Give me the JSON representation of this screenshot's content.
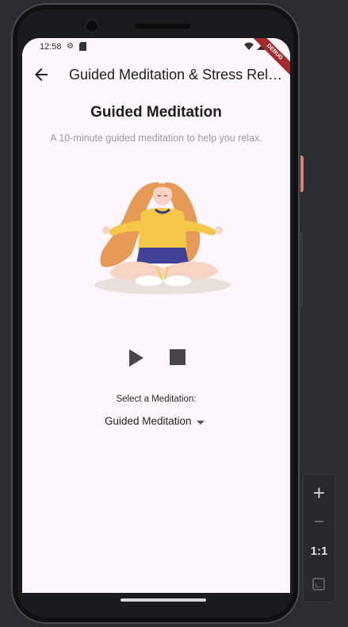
{
  "statusbar": {
    "time": "12:58",
    "debug_label": "DEBUG"
  },
  "appbar": {
    "title": "Guided Meditation & Stress Relief"
  },
  "main": {
    "title": "Guided Meditation",
    "subtitle": "A 10-minute guided meditation to help you relax.",
    "select_label": "Select a Meditation:",
    "selected_meditation": "Guided Meditation"
  },
  "zoom": {
    "zoom_in": "+",
    "zoom_out": "−",
    "ratio": "1:1"
  },
  "colors": {
    "screen_bg": "#fdf6fd",
    "accent_orange": "#d9826a",
    "player_icon": "#46464c"
  }
}
